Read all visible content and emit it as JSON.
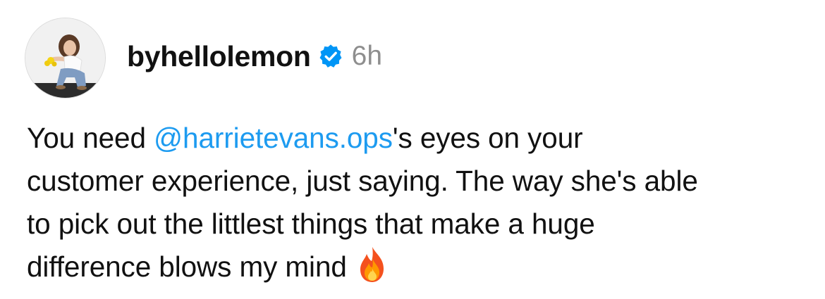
{
  "post": {
    "author": {
      "username": "byhellolemon",
      "verified": true,
      "avatar_icon": "profile-photo-avatar"
    },
    "timestamp": "6h",
    "caption": {
      "line1_before": "You need ",
      "mention": "@harrietevans.ops",
      "line1_after": "'s eyes on your",
      "line2": "customer experience, just saying. The way she's able",
      "line3": "to pick out the littlest things that make a huge",
      "line4": "difference blows my mind",
      "emoji_icon": "fire-icon"
    }
  },
  "colors": {
    "text": "#111111",
    "muted": "#8e8e8e",
    "mention": "#1d9bf0",
    "verified_badge": "#0095f6"
  }
}
